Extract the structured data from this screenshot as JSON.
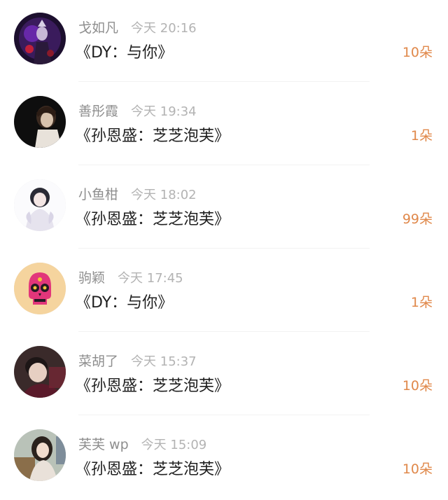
{
  "colors": {
    "name": "#8e8e8e",
    "time": "#b3b3b3",
    "song": "#1f1f1f",
    "gift": "#e0884a",
    "divider": "#f2f2f2"
  },
  "items": [
    {
      "name": "戈如凡",
      "time": "今天 20:16",
      "song": "《DY：与你》",
      "gift": "10朵",
      "avatar_icon": "dark-fantasy-warrior-avatar"
    },
    {
      "name": "善彤霞",
      "time": "今天 19:34",
      "song": "《孙恩盛：芝芝泡芙》",
      "gift": "1朵",
      "avatar_icon": "dark-portrait-avatar"
    },
    {
      "name": "小鱼柑",
      "time": "今天 18:02",
      "song": "《孙恩盛：芝芝泡芙》",
      "gift": "99朵",
      "avatar_icon": "anime-girl-avatar"
    },
    {
      "name": "驹颖",
      "time": "今天 17:45",
      "song": "《DY：与你》",
      "gift": "1朵",
      "avatar_icon": "pink-sugar-skull-avatar"
    },
    {
      "name": "菜胡了",
      "time": "今天 15:37",
      "song": "《孙恩盛：芝芝泡芙》",
      "gift": "10朵",
      "avatar_icon": "young-man-portrait-avatar"
    },
    {
      "name": "芙芙 wp",
      "time": "今天 15:09",
      "song": "《孙恩盛：芝芝泡芙》",
      "gift": "10朵",
      "avatar_icon": "girl-photo-avatar"
    }
  ]
}
